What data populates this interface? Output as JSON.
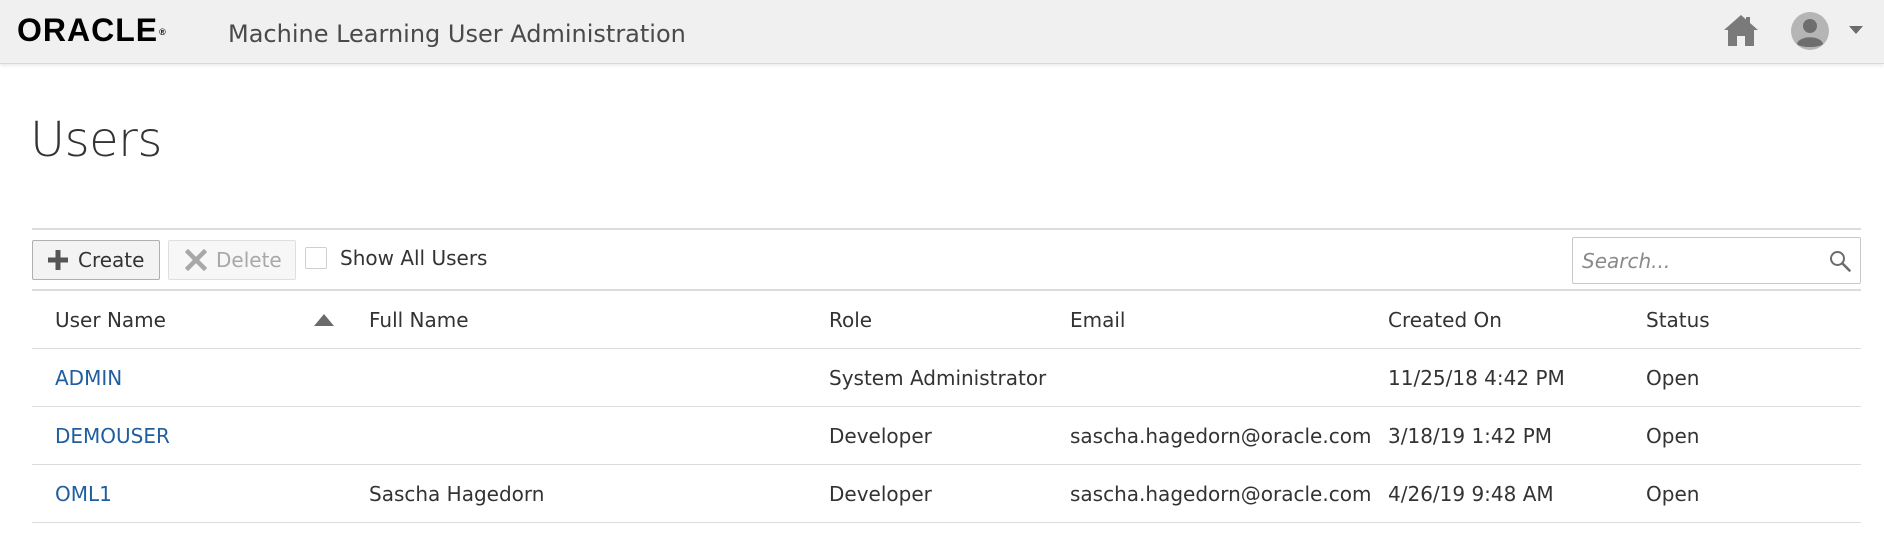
{
  "header": {
    "logo_text": "ORACLE",
    "logo_mark": "®",
    "app_title": "Machine Learning User Administration",
    "home_icon": "home-icon",
    "avatar_icon": "user-avatar-icon",
    "menu_icon": "caret-down-icon"
  },
  "page": {
    "title": "Users"
  },
  "toolbar": {
    "create_label": "Create",
    "delete_label": "Delete",
    "show_all_label": "Show All Users",
    "show_all_checked": false,
    "search_placeholder": "Search...",
    "search_value": ""
  },
  "table": {
    "columns": {
      "user_name": "User Name",
      "full_name": "Full Name",
      "role": "Role",
      "email": "Email",
      "created_on": "Created On",
      "status": "Status"
    },
    "sort": "ascending",
    "rows": [
      {
        "user_name": "ADMIN",
        "full_name": "",
        "role": "System Administrator",
        "email": "",
        "created_on": "11/25/18 4:42 PM",
        "status": "Open"
      },
      {
        "user_name": "DEMOUSER",
        "full_name": "",
        "role": "Developer",
        "email": "sascha.hagedorn@oracle.com",
        "created_on": "3/18/19 1:42 PM",
        "status": "Open"
      },
      {
        "user_name": "OML1",
        "full_name": "Sascha Hagedorn",
        "role": "Developer",
        "email": "sascha.hagedorn@oracle.com",
        "created_on": "4/26/19 9:48 AM",
        "status": "Open"
      }
    ]
  },
  "colors": {
    "header_bg": "#f0f0f0",
    "link": "#1f5f9f",
    "border": "#dcdcdc"
  }
}
